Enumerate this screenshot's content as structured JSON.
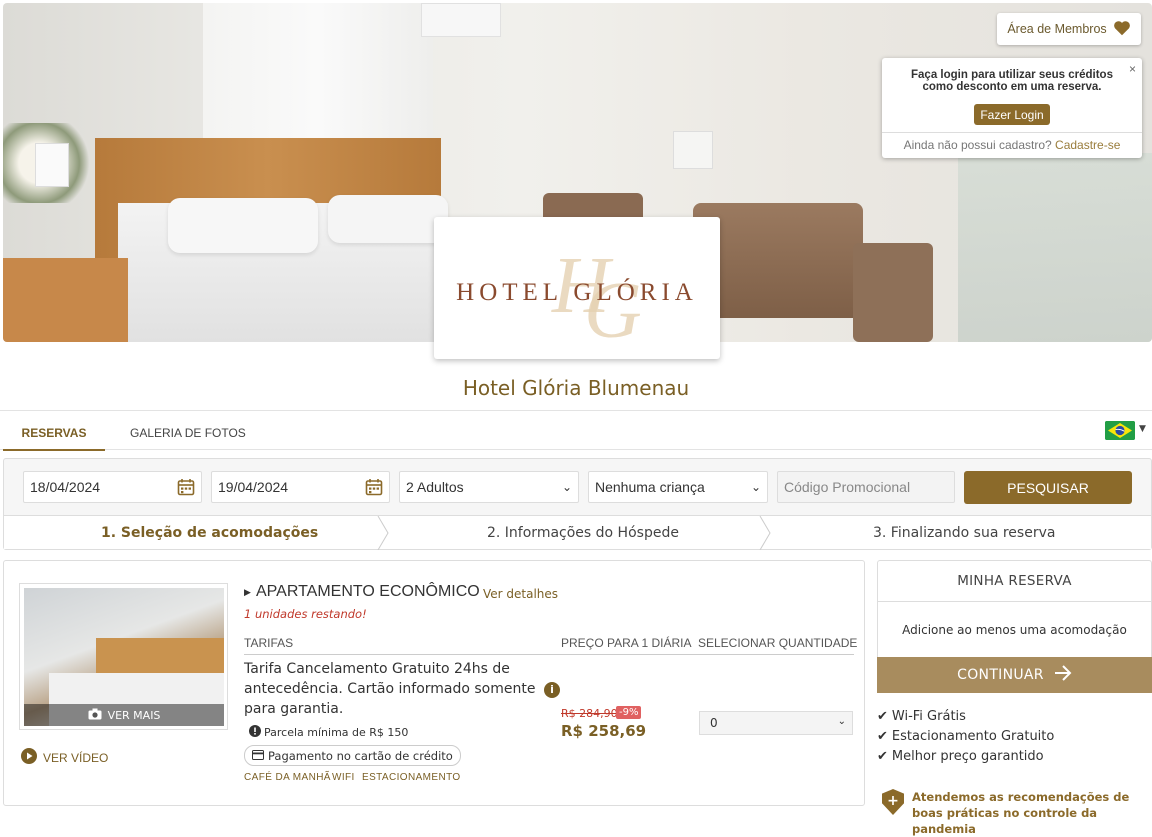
{
  "header": {
    "members_button": "Área de Membros",
    "login_popup": {
      "message": "Faça login para utilizar seus créditos como desconto em uma reserva.",
      "login_button": "Fazer Login",
      "no_account": "Ainda não possui cadastro?",
      "register_link": "Cadastre-se",
      "close": "×"
    },
    "logo_text": "HOTEL GLÓRIA",
    "hotel_name": "Hotel Glória Blumenau"
  },
  "nav": {
    "tabs": [
      "RESERVAS",
      "GALERIA DE FOTOS"
    ],
    "active_tab": "RESERVAS",
    "language": "pt-BR"
  },
  "search": {
    "checkin": "18/04/2024",
    "checkout": "19/04/2024",
    "adults": "2 Adultos",
    "children": "Nenhuma criança",
    "promo_placeholder": "Código Promocional",
    "search_button": "PESQUISAR"
  },
  "steps": [
    "1. Seleção de acomodações",
    "2. Informações do Hóspede",
    "3. Finalizando sua reserva"
  ],
  "room": {
    "photo_button": "VER MAIS",
    "video_link": "VER VÍDEO",
    "title": "APARTAMENTO ECONÔMICO",
    "details_link": "Ver detalhes",
    "units_left": "1 unidades restando!",
    "headers": {
      "rates": "TARIFAS",
      "price": "PREÇO PARA 1 DIÁRIA",
      "quantity": "SELECIONAR QUANTIDADE"
    },
    "rate_description": "Tarifa Cancelamento Gratuito 24hs de antecedência. Cartão informado somente para garantia.",
    "min_installment": "Parcela mínima de R$ 150",
    "payment_badge": "Pagamento no cartão de crédito",
    "amenities": [
      "CAFÉ DA MANHÃ",
      "WIFI",
      "ESTACIONAMENTO"
    ],
    "old_price": "R$ 284,90",
    "discount": "-9%",
    "price": "R$ 258,69",
    "quantity": "0"
  },
  "sidebar": {
    "title": "MINHA RESERVA",
    "message": "Adicione ao menos uma acomodação",
    "continue_button": "CONTINUAR",
    "perks": [
      "Wi-Fi Grátis",
      "Estacionamento Gratuito",
      "Melhor preço garantido"
    ],
    "pandemic_notice": "Atendemos as recomendações de boas práticas no controle da pandemia"
  },
  "colors": {
    "brand": "#8b6a2a",
    "brand_light": "#a88c5e",
    "alert": "#c0392b"
  }
}
